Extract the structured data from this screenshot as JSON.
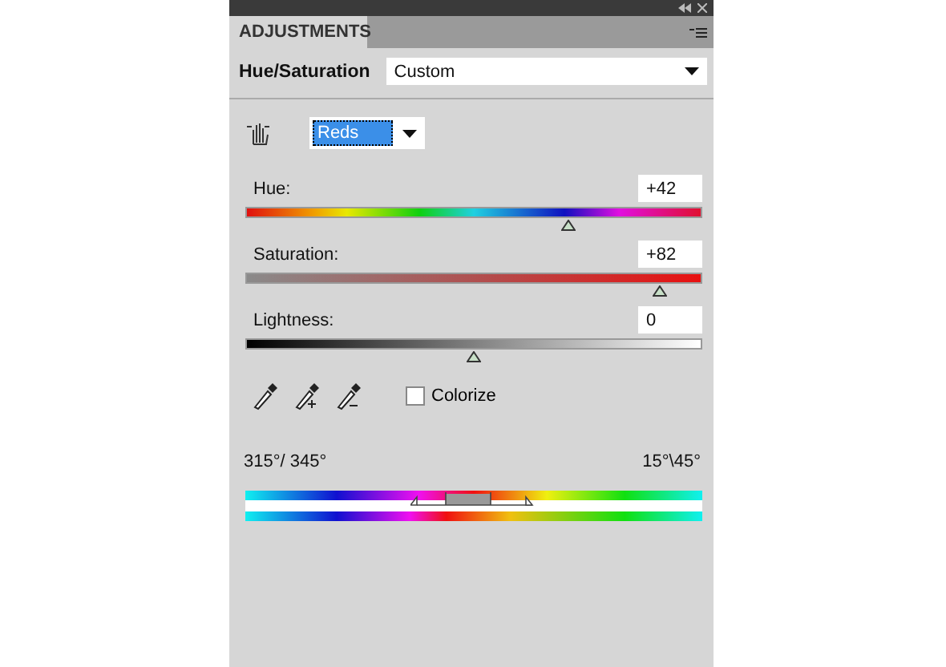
{
  "panel": {
    "tab": "ADJUSTMENTS"
  },
  "preset": {
    "label": "Hue/Saturation",
    "value": "Custom"
  },
  "channel": {
    "value": "Reds"
  },
  "sliders": [
    {
      "kind": "hue",
      "label": "Hue:",
      "value": "+42",
      "level": 0.71
    },
    {
      "kind": "saturation",
      "label": "Saturation:",
      "value": "+82",
      "level": 0.91
    },
    {
      "kind": "lightness",
      "label": "Lightness:",
      "value": "0",
      "level": 0.5
    }
  ],
  "colorize": {
    "label": "Colorize",
    "checked": false
  },
  "range": {
    "left": "315°/ 345°",
    "right": "15°\\45°"
  }
}
